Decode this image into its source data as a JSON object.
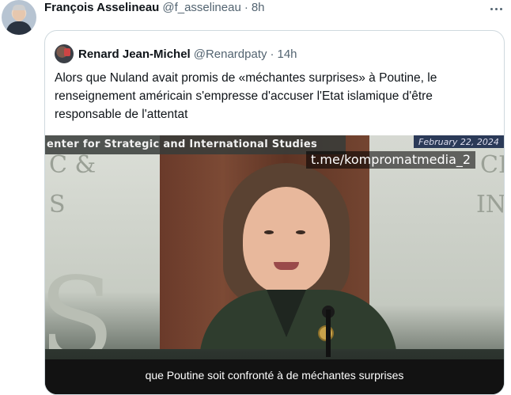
{
  "post": {
    "author_name": "François Asselineau",
    "author_handle": "@f_asselineau",
    "separator": "·",
    "time": "8h"
  },
  "quoted": {
    "author_name": "Renard Jean-Michel",
    "author_handle": "@Renardpaty",
    "separator": "·",
    "time": "14h",
    "text": "Alors que Nuland avait promis de «méchantes surprises» à Poutine, le renseignement américain s'empresse d'accuser l'Etat islamique d'être responsable de l'attentat"
  },
  "video": {
    "banner_text": "enter for Strategic and International Studies",
    "date_text": "February 22, 2024",
    "watermark": "t.me/kompromatmedia_2",
    "subtitle": "que Poutine soit confronté à de méchantes surprises",
    "bg_letters": {
      "left_1": "C &",
      "left_2": "S",
      "left_big": "S",
      "right_1": "CE",
      "right_2": "IN"
    }
  },
  "icons": {
    "more": "more-horizontal-icon"
  },
  "colors": {
    "text_primary": "#0f1419",
    "text_secondary": "#536471",
    "border": "#cfd9de"
  }
}
